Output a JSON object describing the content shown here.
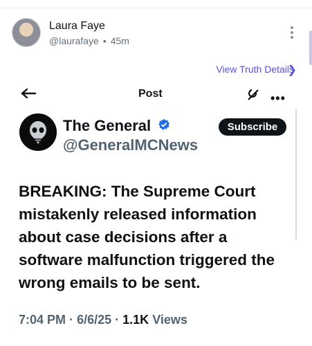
{
  "header": {
    "author_name": "Laura Faye",
    "author_handle": "@laurafaye",
    "dot": "•",
    "time": "45m"
  },
  "link": {
    "view_details": "View Truth Details",
    "chevron": "❯"
  },
  "embedded": {
    "title": "Post",
    "profile": {
      "name": "The General",
      "handle": "@GeneralMCNews",
      "subscribe": "Subscribe"
    },
    "text": "BREAKING: The Supreme Court mistakenly released information about case decisions after a software malfunction triggered the wrong emails to be sent.",
    "meta": {
      "time": "7:04 PM",
      "sep1": "·",
      "date": "6/6/25",
      "sep2": "·",
      "views_count": "1.1K",
      "views_label": "Views"
    }
  },
  "icons": {
    "back": "back-arrow-icon",
    "grok": "grok-icon",
    "more": "more-icon",
    "kebab": "kebab-menu-icon",
    "verified": "verified-badge-icon"
  },
  "colors": {
    "link": "#5b52d6",
    "muted": "#536471",
    "verified": "#1d6fe8"
  }
}
